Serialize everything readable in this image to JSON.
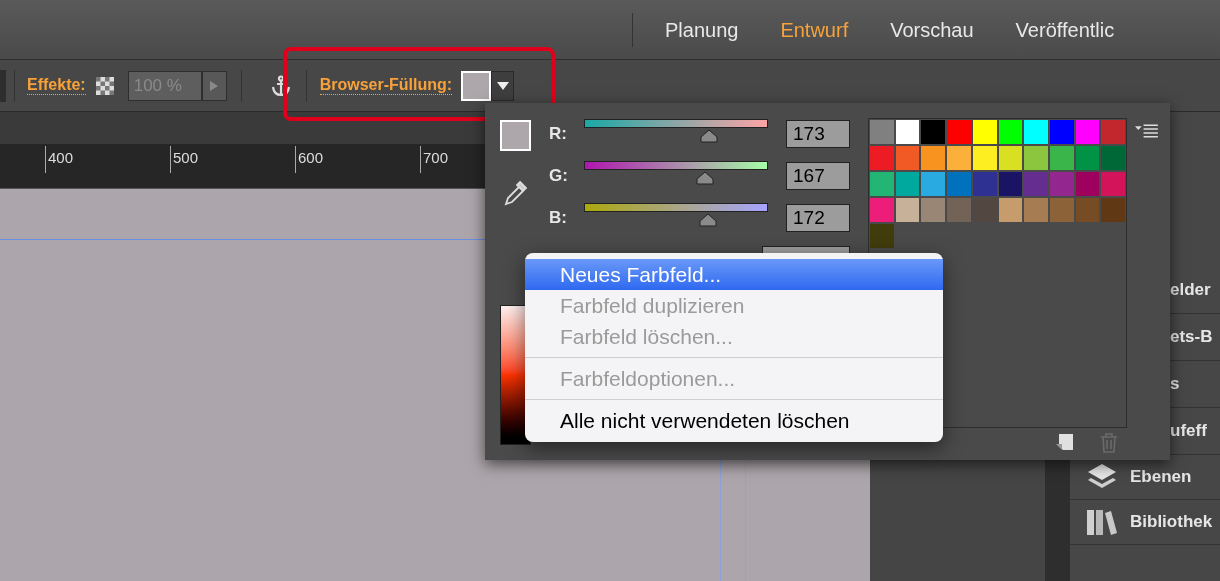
{
  "workspace_tabs": [
    {
      "label": "Planung",
      "selected": false
    },
    {
      "label": "Entwurf",
      "selected": true
    },
    {
      "label": "Vorschau",
      "selected": false
    },
    {
      "label": "Veröffentlic",
      "selected": false
    }
  ],
  "toolbar": {
    "effects_label": "Effekte:",
    "opacity_field": {
      "value": "100 %",
      "disabled": true
    },
    "browser_fill_label": "Browser-Füllung:"
  },
  "ruler": {
    "labels": [
      "400",
      "500",
      "600",
      "700"
    ]
  },
  "color_panel": {
    "channels": [
      {
        "label": "R:",
        "value": "173",
        "level": 0.678
      },
      {
        "label": "G:",
        "value": "167",
        "level": 0.655
      },
      {
        "label": "B:",
        "value": "172",
        "level": 0.675
      }
    ],
    "swatches": [
      {
        "color": "#808080"
      },
      {
        "color": "#ffffff"
      },
      {
        "color": "#000000"
      },
      {
        "color": "#ff0000"
      },
      {
        "color": "#ffff00"
      },
      {
        "color": "#00ff00"
      },
      {
        "color": "#00ffff"
      },
      {
        "color": "#0000ff"
      },
      {
        "color": "#ff00ff"
      },
      {
        "color": "#c1272d"
      },
      {
        "color": "#ed1c24"
      },
      {
        "color": "#f15a24"
      },
      {
        "color": "#f7931e"
      },
      {
        "color": "#fbb03b"
      },
      {
        "color": "#fcee21"
      },
      {
        "color": "#d9e021"
      },
      {
        "color": "#8cc63f"
      },
      {
        "color": "#39b54a"
      },
      {
        "color": "#009245"
      },
      {
        "color": "#006837"
      },
      {
        "color": "#22b573"
      },
      {
        "color": "#00a99d"
      },
      {
        "color": "#29abe2"
      },
      {
        "color": "#0071bc"
      },
      {
        "color": "#2e3192"
      },
      {
        "color": "#1b1464"
      },
      {
        "color": "#662d91"
      },
      {
        "color": "#93278f"
      },
      {
        "color": "#9e005d"
      },
      {
        "color": "#d4145a"
      },
      {
        "color": "#ed1e79"
      },
      {
        "color": "#c7b299"
      },
      {
        "color": "#998675"
      },
      {
        "color": "#736357"
      },
      {
        "color": "#534741"
      },
      {
        "color": "#c69c6d"
      },
      {
        "color": "#a67c52"
      },
      {
        "color": "#8c6239"
      },
      {
        "color": "#754c24"
      },
      {
        "color": "#603813"
      },
      {
        "color": "#403c0c"
      }
    ],
    "delete_button": {
      "disabled": true
    }
  },
  "context_menu": {
    "groups": [
      {
        "items": [
          {
            "label": "Neues Farbfeld...",
            "selected": true,
            "disabled": false
          },
          {
            "label": "Farbfeld duplizieren",
            "selected": false,
            "disabled": true
          },
          {
            "label": "Farbfeld löschen...",
            "selected": false,
            "disabled": true
          }
        ]
      },
      {
        "items": [
          {
            "label": "Farbfeldoptionen...",
            "selected": false,
            "disabled": true
          }
        ]
      },
      {
        "items": [
          {
            "label": "Alle nicht verwendeten löschen",
            "selected": false,
            "disabled": false
          }
        ]
      }
    ]
  },
  "side_panel": {
    "items": [
      {
        "label": "elder",
        "kind": "plain"
      },
      {
        "label": "ets-B",
        "kind": "plain"
      },
      {
        "label": "s",
        "kind": "plain"
      },
      {
        "label": "ufeff",
        "kind": "plain"
      },
      {
        "label": "Ebenen",
        "kind": "layers"
      },
      {
        "label": "Bibliothek",
        "kind": "libraries"
      }
    ]
  }
}
